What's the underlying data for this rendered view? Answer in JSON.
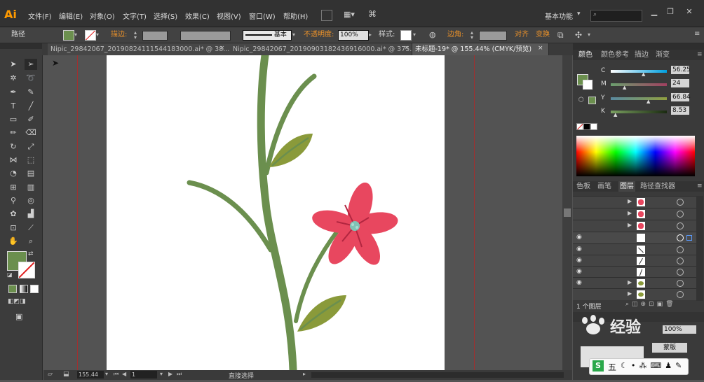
{
  "app": {
    "logo": "Ai",
    "workspace": "基本功能"
  },
  "menu": [
    "文件(F)",
    "编辑(E)",
    "对象(O)",
    "文字(T)",
    "选择(S)",
    "效果(C)",
    "视图(V)",
    "窗口(W)",
    "帮助(H)"
  ],
  "control": {
    "selection_label": "路径",
    "stroke_label": "描边:",
    "stroke_style": "基本",
    "opacity_label": "不透明度:",
    "opacity_value": "100%",
    "style_label": "样式:",
    "corner_label": "边角:",
    "align_label": "对齐",
    "transform_label": "变换"
  },
  "tabs": [
    "Nipic_29842067_20190824111544183000.ai* @ 38...",
    "Nipic_29842067_20190903182436916000.ai* @ 375...",
    "未标题-19* @ 155.44% (CMYK/预览)"
  ],
  "color_panel": {
    "tabs": [
      "颜色",
      "颜色参考",
      "描边",
      "渐变"
    ],
    "fill_color": "#6b8f4e",
    "channels": [
      {
        "name": "C",
        "value": "56.25"
      },
      {
        "name": "M",
        "value": "24"
      },
      {
        "name": "Y",
        "value": "66.84"
      },
      {
        "name": "K",
        "value": "8.53"
      }
    ]
  },
  "layers_panel": {
    "tabs": [
      "色板",
      "画笔",
      "图层",
      "路径查找器"
    ],
    "count_label": "1 个图层"
  },
  "status": {
    "zoom": "155.44",
    "page": "1",
    "tool_name": "直接选择"
  },
  "watermark": {
    "text": "Baidu经验",
    "ime_text": "五"
  },
  "colors": {
    "stem": "#6b8f4e",
    "leaf": "#8a9a3a",
    "petal": "#e8475f",
    "center": "#7fc4b6",
    "accent": "#e8902a"
  }
}
